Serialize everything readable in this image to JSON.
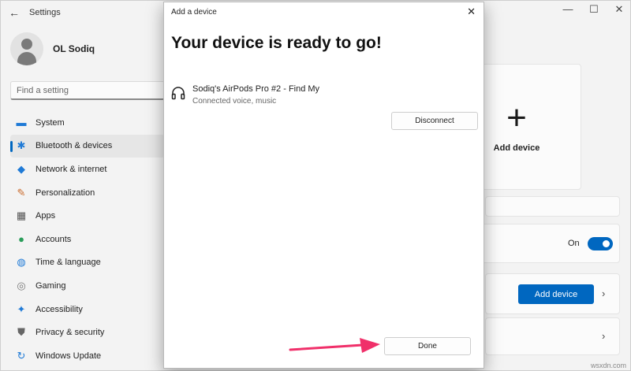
{
  "window": {
    "title": "Settings",
    "back_glyph": "←",
    "minimize_glyph": "—",
    "maximize_glyph": "☐",
    "close_glyph": "✕"
  },
  "profile": {
    "name": "OL Sodiq"
  },
  "search": {
    "placeholder": "Find a setting"
  },
  "sidebar": {
    "items": [
      {
        "label": "System",
        "icon": "monitor-icon",
        "glyph": "▬",
        "color": "#1f7ad6"
      },
      {
        "label": "Bluetooth & devices",
        "icon": "bluetooth-icon",
        "glyph": "✱",
        "color": "#1f7ad6",
        "selected": true
      },
      {
        "label": "Network & internet",
        "icon": "wifi-icon",
        "glyph": "◆",
        "color": "#1f7ad6"
      },
      {
        "label": "Personalization",
        "icon": "brush-icon",
        "glyph": "✎",
        "color": "#c96a2b"
      },
      {
        "label": "Apps",
        "icon": "apps-icon",
        "glyph": "▦",
        "color": "#555555"
      },
      {
        "label": "Accounts",
        "icon": "person-icon",
        "glyph": "●",
        "color": "#2a9d5a"
      },
      {
        "label": "Time & language",
        "icon": "globe-icon",
        "glyph": "◍",
        "color": "#1f7ad6"
      },
      {
        "label": "Gaming",
        "icon": "gamepad-icon",
        "glyph": "◎",
        "color": "#777777"
      },
      {
        "label": "Accessibility",
        "icon": "accessibility-icon",
        "glyph": "✦",
        "color": "#1f7ad6"
      },
      {
        "label": "Privacy & security",
        "icon": "shield-icon",
        "glyph": "⛊",
        "color": "#666666"
      },
      {
        "label": "Windows Update",
        "icon": "update-icon",
        "glyph": "↻",
        "color": "#1f7ad6"
      }
    ]
  },
  "background": {
    "add_device_tile": {
      "plus_glyph": "+",
      "label": "Add device"
    },
    "bluetooth_toggle": {
      "state_label": "On",
      "on": true
    },
    "add_device_button": "Add device",
    "chevron_glyph": "›"
  },
  "dialog": {
    "title": "Add a device",
    "close_glyph": "✕",
    "heading": "Your device is ready to go!",
    "device": {
      "name": "Sodiq's AirPods Pro #2 - Find My",
      "status": "Connected voice, music",
      "icon": "headphones-icon"
    },
    "disconnect_label": "Disconnect",
    "done_label": "Done"
  },
  "annotation": {
    "arrow_color": "#f0306a"
  },
  "watermark": "wsxdn.com",
  "colors": {
    "accent": "#0067c0",
    "background": "#f3f3f3"
  }
}
